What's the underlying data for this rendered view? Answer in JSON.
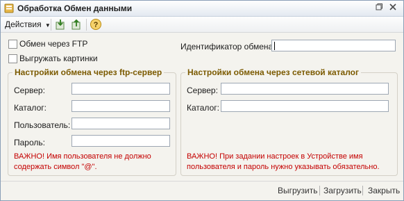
{
  "window": {
    "title": "Обработка  Обмен данными",
    "icon": "form-icon",
    "controls": [
      "restore-icon",
      "close-icon"
    ]
  },
  "toolbar": {
    "actions_label": "Действия",
    "icons": [
      "export-green-icon",
      "import-green-icon",
      "help-icon"
    ]
  },
  "options": {
    "ftp_exchange": {
      "label": "Обмен через FTP",
      "checked": false
    },
    "upload_pictures": {
      "label": "Выгружать картинки",
      "checked": false
    }
  },
  "exchange_id": {
    "label": "Идентификатор обмена:",
    "value": ""
  },
  "ftp_group": {
    "title": "Настройки обмена через ftp-сервер",
    "server_label": "Сервер:",
    "catalog_label": "Каталог:",
    "user_label": "Пользователь:",
    "password_label": "Пароль:",
    "server_value": "",
    "catalog_value": "",
    "user_value": "",
    "password_value": "",
    "warning": "ВАЖНО! Имя пользователя не должно содержать символ \"@\"."
  },
  "network_group": {
    "title": "Настройки обмена через сетевой каталог",
    "server_label": "Сервер:",
    "catalog_label": "Каталог:",
    "server_value": "",
    "catalog_value": "",
    "warning": "ВАЖНО! При задании настроек в Устройстве имя пользователя и пароль нужно указывать обязательно."
  },
  "footer": {
    "upload": "Выгрузить",
    "download": "Загрузить",
    "close": "Закрыть"
  },
  "colors": {
    "accent": "#7b5a00",
    "warning": "#c40000",
    "background": "#f4f3ee"
  }
}
